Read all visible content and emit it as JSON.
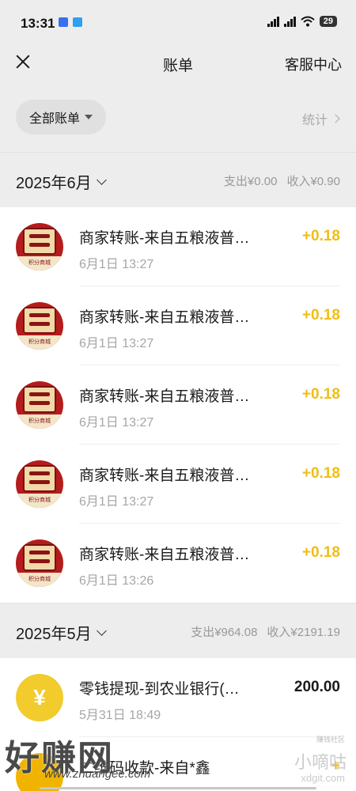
{
  "status_bar": {
    "time": "13:31",
    "battery": "29"
  },
  "nav": {
    "title": "账单",
    "right_label": "客服中心"
  },
  "filter": {
    "all_bills_label": "全部账单",
    "stats_label": "统计"
  },
  "months": [
    {
      "label": "2025年6月",
      "expense": "支出¥0.00",
      "income": "收入¥0.90",
      "items": [
        {
          "title": "商家转账-来自五粮液普…",
          "time": "6月1日 13:27",
          "amount": "+0.18",
          "icon": "wuliangye-points-mall-logo"
        },
        {
          "title": "商家转账-来自五粮液普…",
          "time": "6月1日 13:27",
          "amount": "+0.18",
          "icon": "wuliangye-points-mall-logo"
        },
        {
          "title": "商家转账-来自五粮液普…",
          "time": "6月1日 13:27",
          "amount": "+0.18",
          "icon": "wuliangye-points-mall-logo"
        },
        {
          "title": "商家转账-来自五粮液普…",
          "time": "6月1日 13:27",
          "amount": "+0.18",
          "icon": "wuliangye-points-mall-logo"
        },
        {
          "title": "商家转账-来自五粮液普…",
          "time": "6月1日 13:26",
          "amount": "+0.18",
          "icon": "wuliangye-points-mall-logo"
        }
      ]
    },
    {
      "label": "2025年5月",
      "expense": "支出¥964.08",
      "income": "收入¥2191.19",
      "items": [
        {
          "title": "零钱提现-到农业银行(…",
          "time": "5月31日 18:49",
          "amount": "200.00",
          "icon": "yuan-coin-icon"
        },
        {
          "title": "二维码收款-来自*鑫",
          "time": "",
          "amount": "+",
          "icon": "qr-receipt-icon"
        }
      ]
    }
  ],
  "logo_texts": {
    "avatar_band": "积分商城",
    "coin_symbol": "¥"
  },
  "watermark": {
    "brand": "好赚网",
    "url": "www.zhuangee.com",
    "right_top": "赚钱社区",
    "right_mid": "小嘀咕",
    "right_bot": "xdgit.com"
  },
  "colors": {
    "income_amount": "#f2bd12",
    "background": "#ededed",
    "coin": "#f2cb2c"
  }
}
